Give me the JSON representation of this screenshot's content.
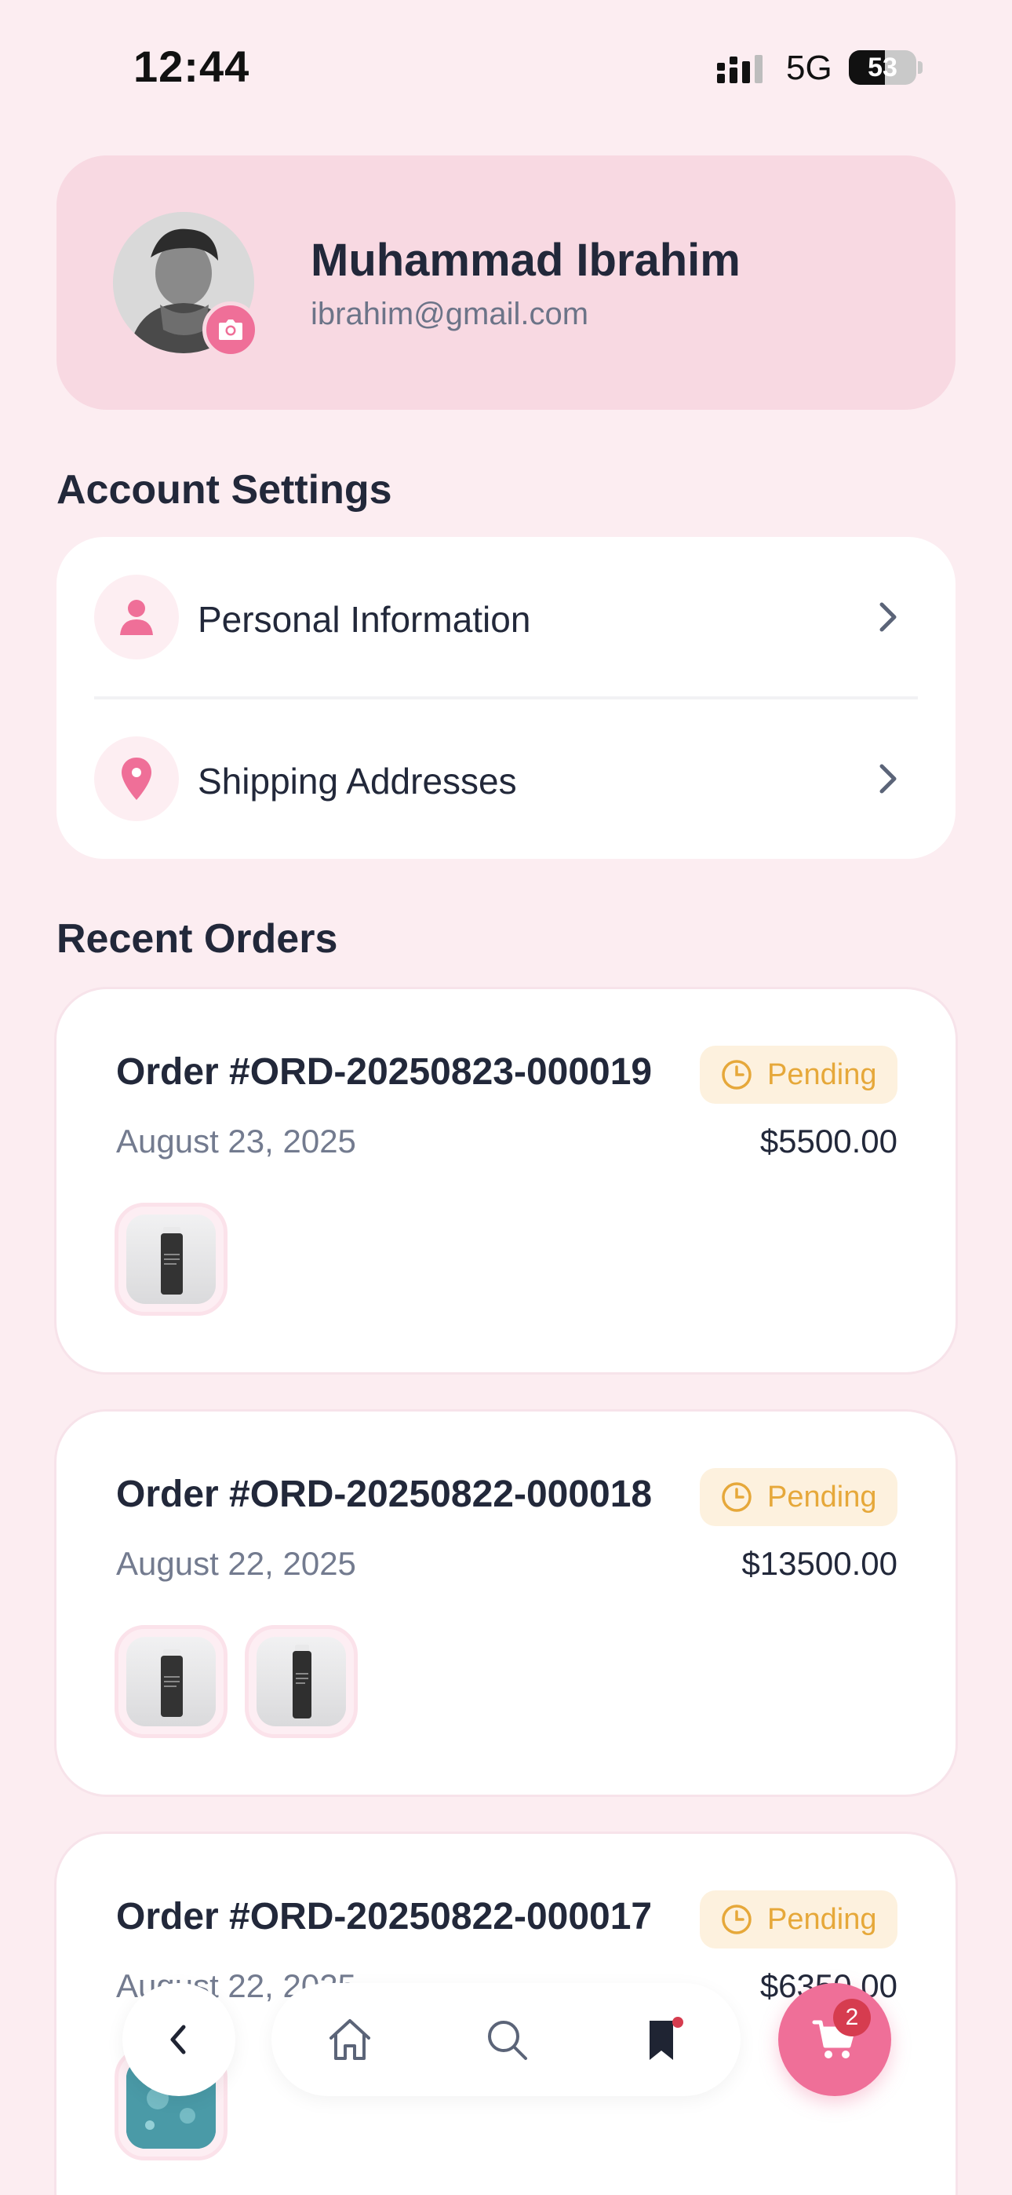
{
  "status_bar": {
    "time": "12:44",
    "network": "5G",
    "battery": "53",
    "battery_level_percent": 53
  },
  "profile": {
    "name": "Muhammad Ibrahim",
    "email": "ibrahim@gmail.com"
  },
  "account_settings": {
    "title": "Account Settings",
    "items": [
      {
        "label": "Personal Information",
        "icon": "person-icon"
      },
      {
        "label": "Shipping Addresses",
        "icon": "location-pin-icon"
      }
    ]
  },
  "recent_orders": {
    "title": "Recent Orders",
    "orders": [
      {
        "id": "Order #ORD-20250823-000019",
        "status": "Pending",
        "date": "August 23, 2025",
        "total": "$5500.00",
        "item_count": 1
      },
      {
        "id": "Order #ORD-20250822-000018",
        "status": "Pending",
        "date": "August 22, 2025",
        "total": "$13500.00",
        "item_count": 2
      },
      {
        "id": "Order #ORD-20250822-000017",
        "status": "Pending",
        "date": "August 22, 2025",
        "total": "$6350.00",
        "item_count": 1
      }
    ]
  },
  "bottom_nav": {
    "items": [
      "back-icon",
      "home-icon",
      "search-icon",
      "bookmark-icon",
      "cart-icon"
    ],
    "cart_count": "2"
  },
  "colors": {
    "background": "#fcedf1",
    "accent": "#ef6f98",
    "pending": "#e6a83a",
    "pending_bg": "#fdf1de",
    "badge": "#d63c4f"
  }
}
